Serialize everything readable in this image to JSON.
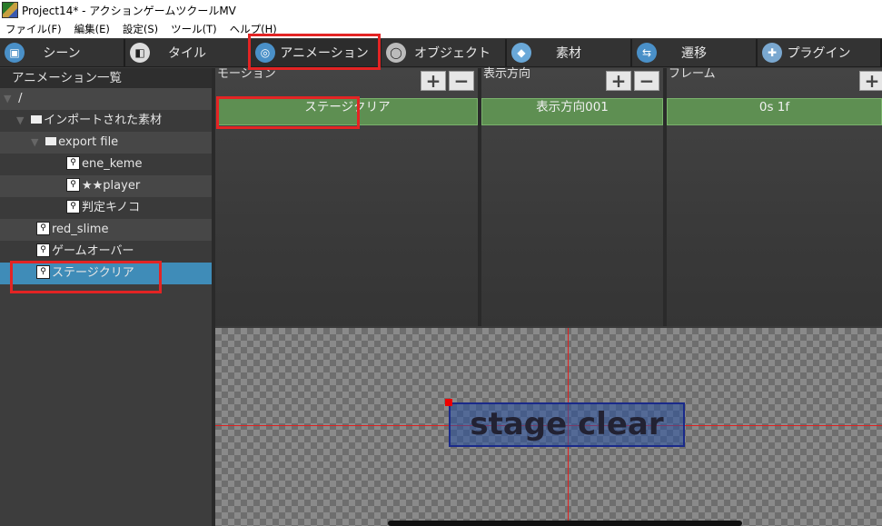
{
  "window": {
    "title": "Project14* - アクションゲームツクールMV"
  },
  "menu": [
    "ファイル(F)",
    "編集(E)",
    "設定(S)",
    "ツール(T)",
    "ヘルプ(H)"
  ],
  "tabs": [
    {
      "label": "シーン",
      "icon": "scene-icon"
    },
    {
      "label": "タイル",
      "icon": "tile-icon"
    },
    {
      "label": "アニメーション",
      "icon": "animation-icon"
    },
    {
      "label": "オブジェクト",
      "icon": "object-icon"
    },
    {
      "label": "素材",
      "icon": "material-icon"
    },
    {
      "label": "遷移",
      "icon": "transition-icon"
    },
    {
      "label": "プラグイン",
      "icon": "plugin-icon"
    }
  ],
  "active_tab": "アニメーション",
  "left_panel": {
    "title": "アニメーション一覧",
    "tree": [
      {
        "label": "/"
      },
      {
        "label": "インポートされた素材"
      },
      {
        "label": "export file"
      },
      {
        "label": "ene_keme"
      },
      {
        "label": "★★player"
      },
      {
        "label": "判定キノコ"
      },
      {
        "label": "red_slime"
      },
      {
        "label": "ゲームオーバー"
      },
      {
        "label": "ステージクリア"
      }
    ],
    "selected": "ステージクリア"
  },
  "columns": {
    "motion": {
      "title": "モーション",
      "item": "ステージクリア"
    },
    "direction": {
      "title": "表示方向",
      "item": "表示方向001"
    },
    "frame": {
      "title": "フレーム",
      "item": "0s 1f"
    }
  },
  "buttons": {
    "add": "+",
    "remove": "−"
  },
  "preview": {
    "text": "stage clear"
  },
  "colors": {
    "highlight": "#e32424",
    "selected_row": "#3f8cb8",
    "item_green": "#5e8f52"
  }
}
